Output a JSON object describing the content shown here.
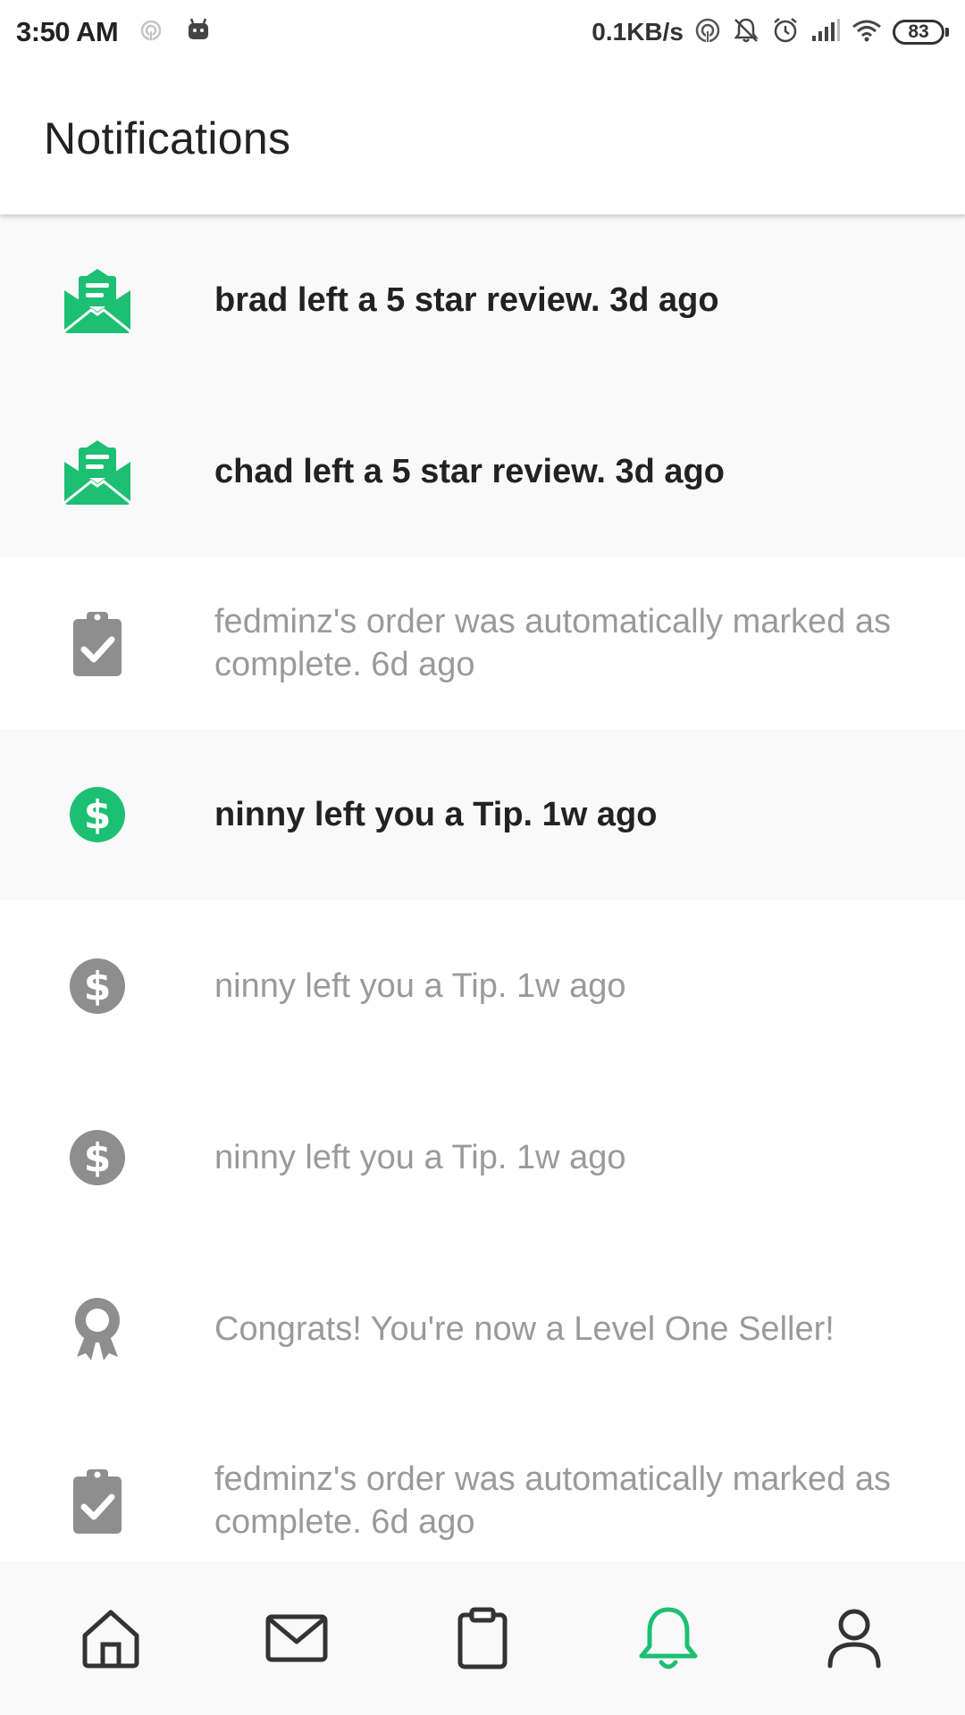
{
  "status_bar": {
    "time": "3:50 AM",
    "net_speed": "0.1KB/s",
    "battery": "83",
    "icons": [
      "hotspot-icon",
      "android-debug-icon",
      "hotspot-icon",
      "bell-muted-icon",
      "alarm-icon",
      "signal-icon",
      "wifi-icon",
      "battery-icon"
    ]
  },
  "header": {
    "title": "Notifications"
  },
  "colors": {
    "accent": "#1dbf73",
    "muted_icon": "#8e8e8e",
    "unread_bg": "#f9f9f9",
    "read_text": "#9a9a9a"
  },
  "notifications": [
    {
      "text": "brad left a 5 star review. 3d ago",
      "icon": "review-envelope-icon",
      "unread": true
    },
    {
      "text": "chad left a 5 star review. 3d ago",
      "icon": "review-envelope-icon",
      "unread": true
    },
    {
      "text": "fedminz's order was automatically marked as complete. 6d ago",
      "icon": "clipboard-check-icon",
      "unread": false
    },
    {
      "text": "ninny left you a Tip. 1w ago",
      "icon": "dollar-icon",
      "unread": true
    },
    {
      "text": "ninny left you a Tip. 1w ago",
      "icon": "dollar-icon",
      "unread": false
    },
    {
      "text": "ninny left you a Tip. 1w ago",
      "icon": "dollar-icon",
      "unread": false
    },
    {
      "text": "Congrats! You're now a Level One Seller!",
      "icon": "award-icon",
      "unread": false
    },
    {
      "text": "fedminz's order was automatically marked as complete. 6d ago",
      "icon": "clipboard-check-icon",
      "unread": false
    }
  ],
  "bottom_nav": [
    {
      "icon": "home-icon",
      "active": false
    },
    {
      "icon": "mail-icon",
      "active": false
    },
    {
      "icon": "clipboard-icon",
      "active": false
    },
    {
      "icon": "bell-icon",
      "active": true
    },
    {
      "icon": "profile-icon",
      "active": false
    }
  ]
}
